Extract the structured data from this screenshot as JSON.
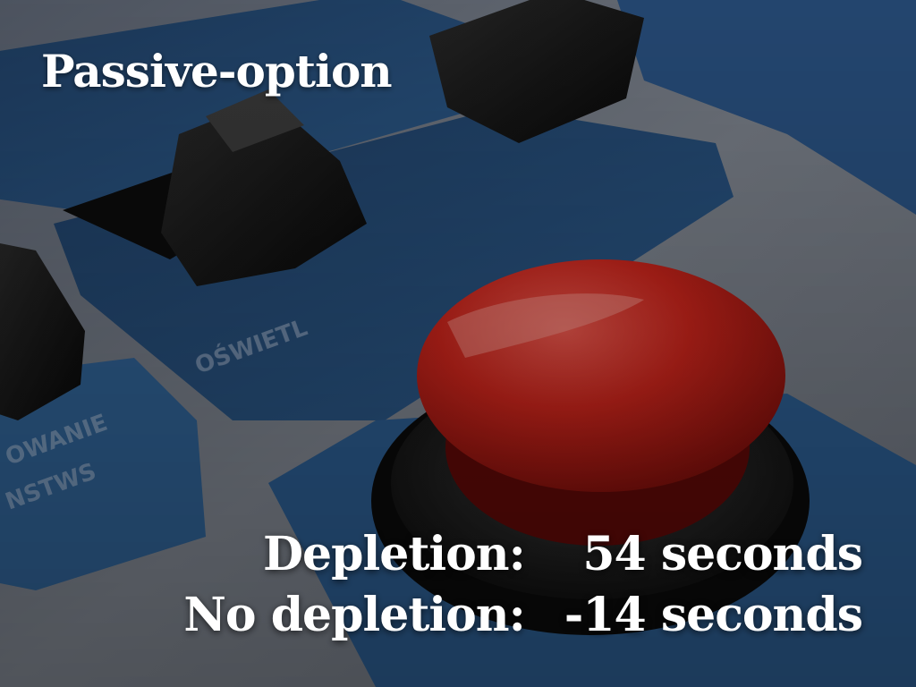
{
  "slide": {
    "title": "Passive-option",
    "rows": [
      {
        "label": "Depletion:",
        "value": "54 seconds"
      },
      {
        "label": "No depletion:",
        "value": "-14 seconds"
      }
    ]
  },
  "background": {
    "panel_text": [
      "OŚWIETL...",
      "...OWANIE",
      "...NSTWS"
    ],
    "colors": {
      "panel_blue": "#2d5a8c",
      "metal_gray": "#8a9099",
      "button_red": "#c7231c",
      "knob_black": "#121212"
    }
  }
}
